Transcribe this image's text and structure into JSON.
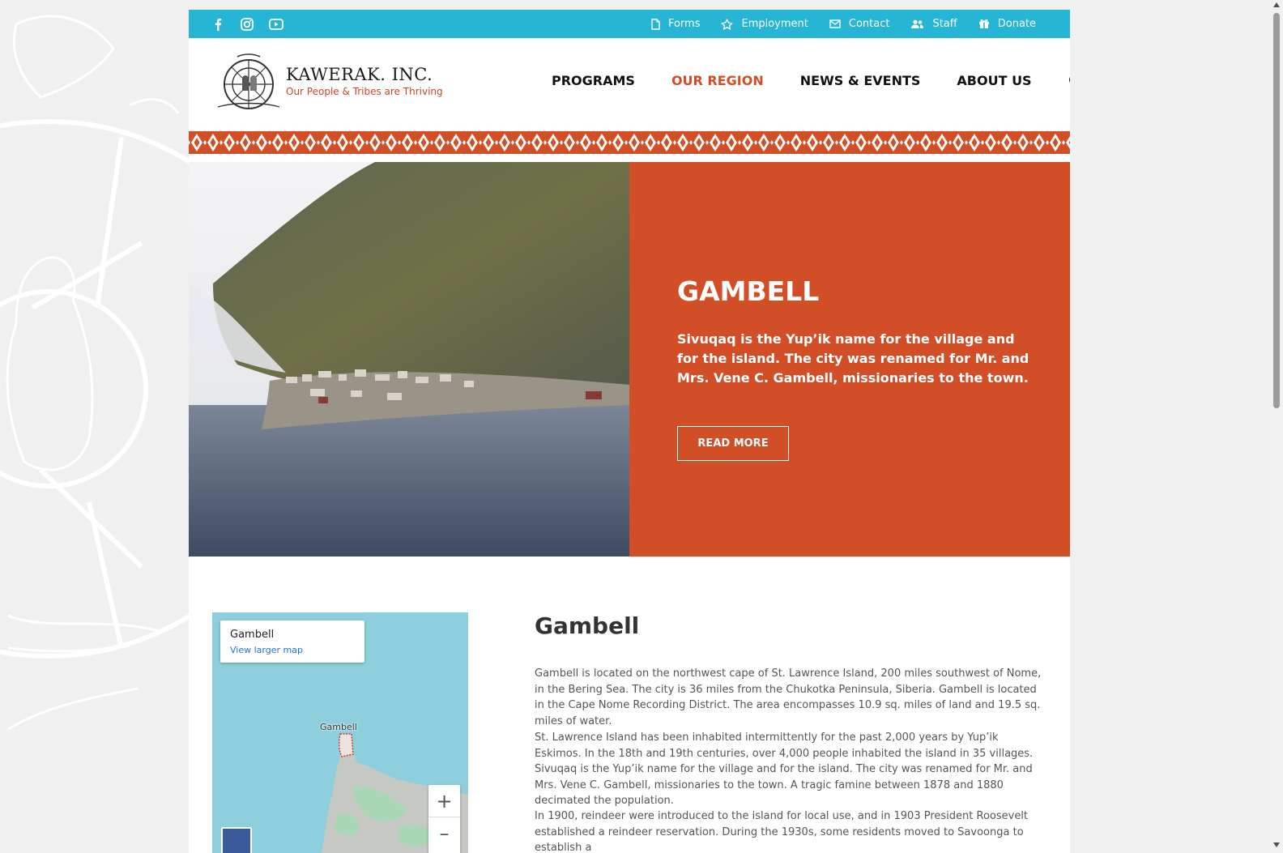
{
  "topbar": {
    "social": [
      {
        "icon": "facebook-icon"
      },
      {
        "icon": "instagram-icon"
      },
      {
        "icon": "youtube-icon"
      }
    ],
    "links": [
      {
        "label": "Forms",
        "icon": "document-icon"
      },
      {
        "label": "Employment",
        "icon": "star-icon"
      },
      {
        "label": "Contact",
        "icon": "envelope-icon"
      },
      {
        "label": "Staff",
        "icon": "users-icon"
      },
      {
        "label": "Donate",
        "icon": "gift-icon"
      }
    ]
  },
  "brand": {
    "name": "KAWERAK. INC.",
    "tagline": "Our People & Tribes are Thriving"
  },
  "nav": {
    "items": [
      {
        "label": "PROGRAMS"
      },
      {
        "label": "OUR REGION",
        "active": true
      },
      {
        "label": "NEWS & EVENTS"
      },
      {
        "label": "ABOUT US"
      }
    ],
    "search_icon": "search-icon"
  },
  "hero": {
    "title": "GAMBELL",
    "text": "Sivuqaq is the Yup’ik name for the village and for the island. The city was renamed for Mr. and Mrs. Vene C. Gambell, missionaries to the town.",
    "button": "READ MORE"
  },
  "map": {
    "card_title": "Gambell",
    "card_link": "View larger map",
    "place_label": "Gambell",
    "zoom_in": "+",
    "zoom_out": "–"
  },
  "article": {
    "title": "Gambell",
    "paragraphs": [
      "Gambell is located on the northwest cape of St. Lawrence Island, 200 miles southwest of Nome, in the Bering Sea. The city is 36 miles from the Chukotka Peninsula, Siberia. Gambell is located in the Cape Nome Recording District. The area encompasses 10.9 sq. miles of land and 19.5 sq. miles of water.",
      "St. Lawrence Island has been inhabited intermittently for the past 2,000 years by Yup’ik Eskimos. In the 18th and 19th centuries, over 4,000 people inhabited the island in 35 villages. Sivuqaq is the Yup’ik name for the village and for the island. The city was renamed for Mr. and Mrs. Vene C. Gambell, missionaries to the town. A tragic famine between 1878 and 1880 decimated the population.",
      "In 1900, reindeer were introduced to the island for local use, and in 1903 President Roosevelt established a reindeer reservation. During the 1930s, some residents moved to Savoonga to establish a"
    ]
  },
  "colors": {
    "topbar": "#26b5d4",
    "accent": "#d24e27",
    "background": "#f0f0f0"
  }
}
